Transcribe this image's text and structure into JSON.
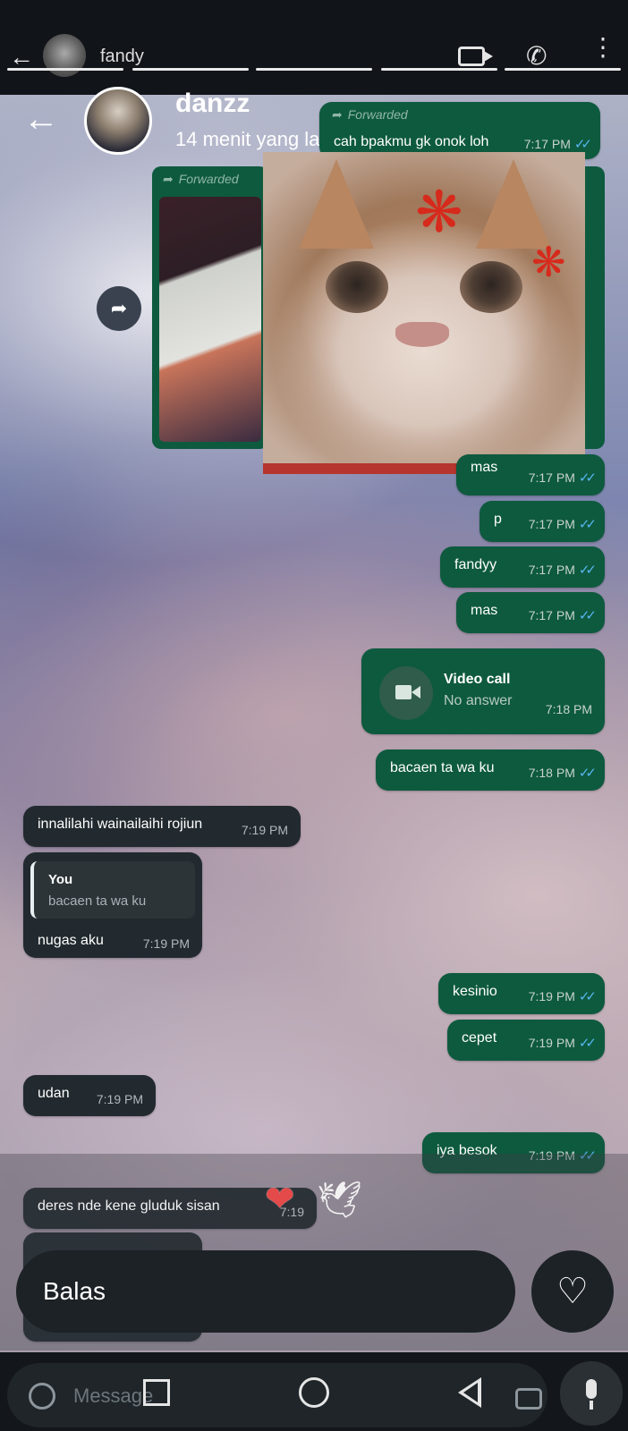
{
  "ghost_header": {
    "name": "fandy"
  },
  "story": {
    "name": "danzz",
    "time": "14 menit yang lalu"
  },
  "chat": {
    "forwarded_label": "Forwarded",
    "forward_text_1": "cah bpakmu gk onok loh",
    "forward_time_1": "7:17 PM",
    "messages": [
      {
        "text": "mas",
        "time": "7:17 PM"
      },
      {
        "text": "p",
        "time": "7:17 PM"
      },
      {
        "text": "fandyy",
        "time": "7:17 PM"
      },
      {
        "text": "mas",
        "time": "7:17 PM"
      }
    ],
    "video_call": {
      "title": "Video call",
      "subtitle": "No answer",
      "time": "7:18 PM"
    },
    "msg_bacaen": {
      "text": "bacaen ta wa ku",
      "time": "7:18 PM"
    },
    "msg_innalilahi": {
      "text": "innalilahi wainailaihi rojiun",
      "time": "7:19 PM"
    },
    "msg_nugas": {
      "quote_author": "You",
      "quote_text": "bacaen ta wa ku",
      "text": "nugas aku",
      "time": "7:19 PM"
    },
    "msg_kesinio": {
      "text": "kesinio",
      "time": "7:19 PM"
    },
    "msg_cepet": {
      "text": "cepet",
      "time": "7:19 PM"
    },
    "msg_udan": {
      "text": "udan",
      "time": "7:19 PM"
    },
    "msg_iya": {
      "text": "iya besok",
      "time": "7:19 PM"
    },
    "msg_deres": {
      "text": "deres nde kene gluduk sisan",
      "time": "7:19"
    }
  },
  "reply": {
    "placeholder": "Balas"
  },
  "composer": {
    "placeholder": "Message"
  },
  "colors": {
    "outgoing": "#0e5a3f",
    "incoming": "#222a2f",
    "ticks": "#56b6f0"
  }
}
